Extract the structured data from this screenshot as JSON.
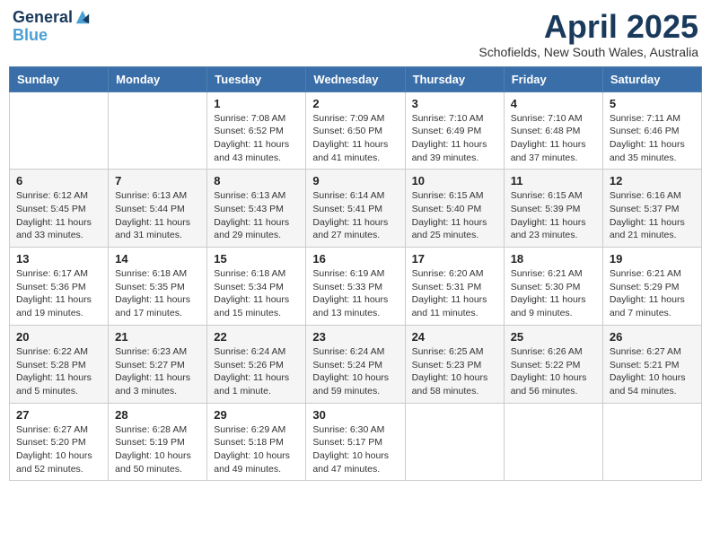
{
  "header": {
    "logo_line1": "General",
    "logo_line2": "Blue",
    "month": "April 2025",
    "location": "Schofields, New South Wales, Australia"
  },
  "days_of_week": [
    "Sunday",
    "Monday",
    "Tuesday",
    "Wednesday",
    "Thursday",
    "Friday",
    "Saturday"
  ],
  "weeks": [
    [
      {
        "day": "",
        "info": ""
      },
      {
        "day": "",
        "info": ""
      },
      {
        "day": "1",
        "info": "Sunrise: 7:08 AM\nSunset: 6:52 PM\nDaylight: 11 hours and 43 minutes."
      },
      {
        "day": "2",
        "info": "Sunrise: 7:09 AM\nSunset: 6:50 PM\nDaylight: 11 hours and 41 minutes."
      },
      {
        "day": "3",
        "info": "Sunrise: 7:10 AM\nSunset: 6:49 PM\nDaylight: 11 hours and 39 minutes."
      },
      {
        "day": "4",
        "info": "Sunrise: 7:10 AM\nSunset: 6:48 PM\nDaylight: 11 hours and 37 minutes."
      },
      {
        "day": "5",
        "info": "Sunrise: 7:11 AM\nSunset: 6:46 PM\nDaylight: 11 hours and 35 minutes."
      }
    ],
    [
      {
        "day": "6",
        "info": "Sunrise: 6:12 AM\nSunset: 5:45 PM\nDaylight: 11 hours and 33 minutes."
      },
      {
        "day": "7",
        "info": "Sunrise: 6:13 AM\nSunset: 5:44 PM\nDaylight: 11 hours and 31 minutes."
      },
      {
        "day": "8",
        "info": "Sunrise: 6:13 AM\nSunset: 5:43 PM\nDaylight: 11 hours and 29 minutes."
      },
      {
        "day": "9",
        "info": "Sunrise: 6:14 AM\nSunset: 5:41 PM\nDaylight: 11 hours and 27 minutes."
      },
      {
        "day": "10",
        "info": "Sunrise: 6:15 AM\nSunset: 5:40 PM\nDaylight: 11 hours and 25 minutes."
      },
      {
        "day": "11",
        "info": "Sunrise: 6:15 AM\nSunset: 5:39 PM\nDaylight: 11 hours and 23 minutes."
      },
      {
        "day": "12",
        "info": "Sunrise: 6:16 AM\nSunset: 5:37 PM\nDaylight: 11 hours and 21 minutes."
      }
    ],
    [
      {
        "day": "13",
        "info": "Sunrise: 6:17 AM\nSunset: 5:36 PM\nDaylight: 11 hours and 19 minutes."
      },
      {
        "day": "14",
        "info": "Sunrise: 6:18 AM\nSunset: 5:35 PM\nDaylight: 11 hours and 17 minutes."
      },
      {
        "day": "15",
        "info": "Sunrise: 6:18 AM\nSunset: 5:34 PM\nDaylight: 11 hours and 15 minutes."
      },
      {
        "day": "16",
        "info": "Sunrise: 6:19 AM\nSunset: 5:33 PM\nDaylight: 11 hours and 13 minutes."
      },
      {
        "day": "17",
        "info": "Sunrise: 6:20 AM\nSunset: 5:31 PM\nDaylight: 11 hours and 11 minutes."
      },
      {
        "day": "18",
        "info": "Sunrise: 6:21 AM\nSunset: 5:30 PM\nDaylight: 11 hours and 9 minutes."
      },
      {
        "day": "19",
        "info": "Sunrise: 6:21 AM\nSunset: 5:29 PM\nDaylight: 11 hours and 7 minutes."
      }
    ],
    [
      {
        "day": "20",
        "info": "Sunrise: 6:22 AM\nSunset: 5:28 PM\nDaylight: 11 hours and 5 minutes."
      },
      {
        "day": "21",
        "info": "Sunrise: 6:23 AM\nSunset: 5:27 PM\nDaylight: 11 hours and 3 minutes."
      },
      {
        "day": "22",
        "info": "Sunrise: 6:24 AM\nSunset: 5:26 PM\nDaylight: 11 hours and 1 minute."
      },
      {
        "day": "23",
        "info": "Sunrise: 6:24 AM\nSunset: 5:24 PM\nDaylight: 10 hours and 59 minutes."
      },
      {
        "day": "24",
        "info": "Sunrise: 6:25 AM\nSunset: 5:23 PM\nDaylight: 10 hours and 58 minutes."
      },
      {
        "day": "25",
        "info": "Sunrise: 6:26 AM\nSunset: 5:22 PM\nDaylight: 10 hours and 56 minutes."
      },
      {
        "day": "26",
        "info": "Sunrise: 6:27 AM\nSunset: 5:21 PM\nDaylight: 10 hours and 54 minutes."
      }
    ],
    [
      {
        "day": "27",
        "info": "Sunrise: 6:27 AM\nSunset: 5:20 PM\nDaylight: 10 hours and 52 minutes."
      },
      {
        "day": "28",
        "info": "Sunrise: 6:28 AM\nSunset: 5:19 PM\nDaylight: 10 hours and 50 minutes."
      },
      {
        "day": "29",
        "info": "Sunrise: 6:29 AM\nSunset: 5:18 PM\nDaylight: 10 hours and 49 minutes."
      },
      {
        "day": "30",
        "info": "Sunrise: 6:30 AM\nSunset: 5:17 PM\nDaylight: 10 hours and 47 minutes."
      },
      {
        "day": "",
        "info": ""
      },
      {
        "day": "",
        "info": ""
      },
      {
        "day": "",
        "info": ""
      }
    ]
  ]
}
